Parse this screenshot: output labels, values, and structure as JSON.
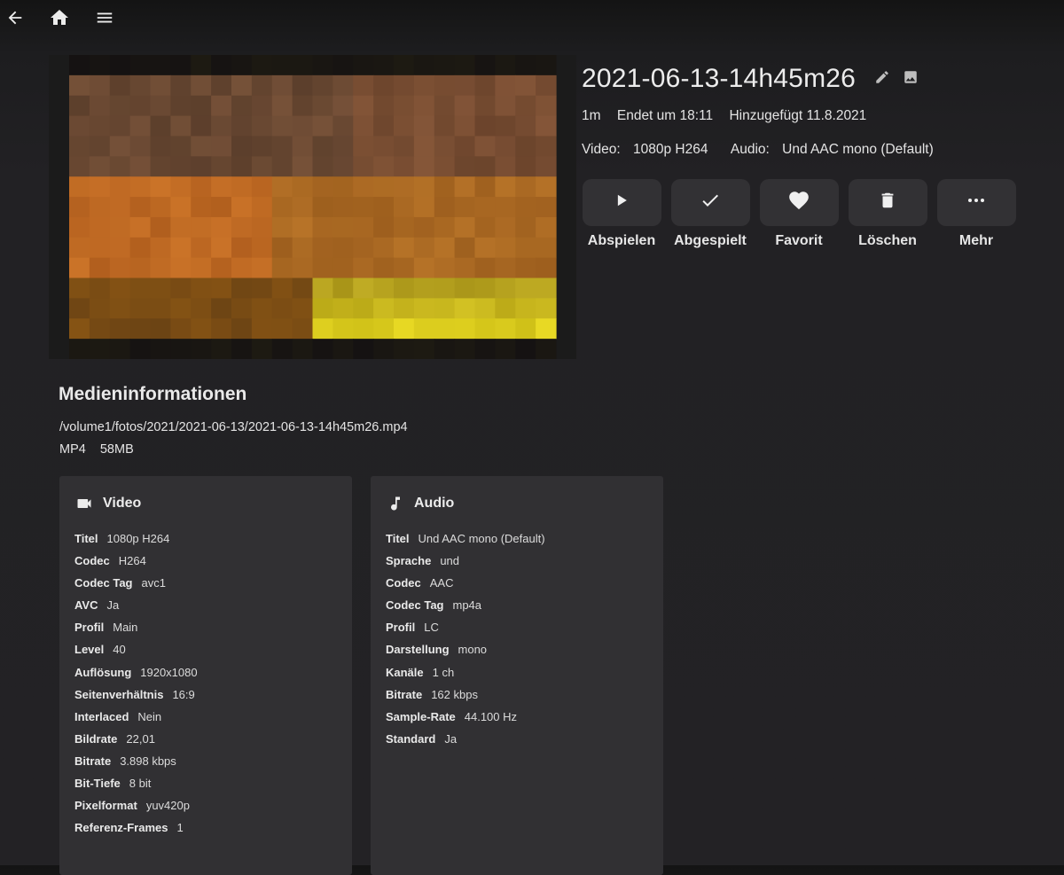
{
  "topbar": {
    "back_icon": "arrow-left-icon",
    "home_icon": "home-icon",
    "menu_icon": "hamburger-menu-icon"
  },
  "item": {
    "title": "2021-06-13-14h45m26",
    "edit_icon": "pencil-icon",
    "image_icon": "image-icon",
    "runtime": "1m",
    "ends_at": "Endet um 18:11",
    "added": "Hinzugefügt 11.8.2021",
    "video_label": "Video:",
    "video_value": "1080p H264",
    "audio_label": "Audio:",
    "audio_value": "Und AAC mono (Default)"
  },
  "actions": [
    {
      "label": "Abspielen",
      "icon": "play-icon"
    },
    {
      "label": "Abgespielt",
      "icon": "checkmark-icon"
    },
    {
      "label": "Favorit",
      "icon": "heart-icon"
    },
    {
      "label": "Löschen",
      "icon": "trash-icon"
    },
    {
      "label": "Mehr",
      "icon": "more-horizontal-icon"
    }
  ],
  "media_info": {
    "heading": "Medieninformationen",
    "path": "/volume1/fotos/2021/2021-06-13/2021-06-13-14h45m26.mp4",
    "container": "MP4",
    "size": "58MB"
  },
  "video_card": {
    "title": "Video",
    "icon": "videocam-icon",
    "rows": [
      {
        "k": "Titel",
        "v": "1080p H264"
      },
      {
        "k": "Codec",
        "v": "H264"
      },
      {
        "k": "Codec Tag",
        "v": "avc1"
      },
      {
        "k": "AVC",
        "v": "Ja"
      },
      {
        "k": "Profil",
        "v": "Main"
      },
      {
        "k": "Level",
        "v": "40"
      },
      {
        "k": "Auflösung",
        "v": "1920x1080"
      },
      {
        "k": "Seitenverhältnis",
        "v": "16:9"
      },
      {
        "k": "Interlaced",
        "v": "Nein"
      },
      {
        "k": "Bildrate",
        "v": "22,01"
      },
      {
        "k": "Bitrate",
        "v": "3.898 kbps"
      },
      {
        "k": "Bit-Tiefe",
        "v": "8 bit"
      },
      {
        "k": "Pixelformat",
        "v": "yuv420p"
      },
      {
        "k": "Referenz-Frames",
        "v": "1"
      }
    ]
  },
  "audio_card": {
    "title": "Audio",
    "icon": "music-note-icon",
    "rows": [
      {
        "k": "Titel",
        "v": "Und AAC mono (Default)"
      },
      {
        "k": "Sprache",
        "v": "und"
      },
      {
        "k": "Codec",
        "v": "AAC"
      },
      {
        "k": "Codec Tag",
        "v": "mp4a"
      },
      {
        "k": "Profil",
        "v": "LC"
      },
      {
        "k": "Darstellung",
        "v": "mono"
      },
      {
        "k": "Kanäle",
        "v": "1 ch"
      },
      {
        "k": "Bitrate",
        "v": "162 kbps"
      },
      {
        "k": "Sample-Rate",
        "v": "44.100 Hz"
      },
      {
        "k": "Standard",
        "v": "Ja"
      }
    ]
  },
  "colors": {
    "background": "#232225",
    "button_bg": "#323134",
    "card_bg": "#313033",
    "text": "#e8e8e8"
  }
}
